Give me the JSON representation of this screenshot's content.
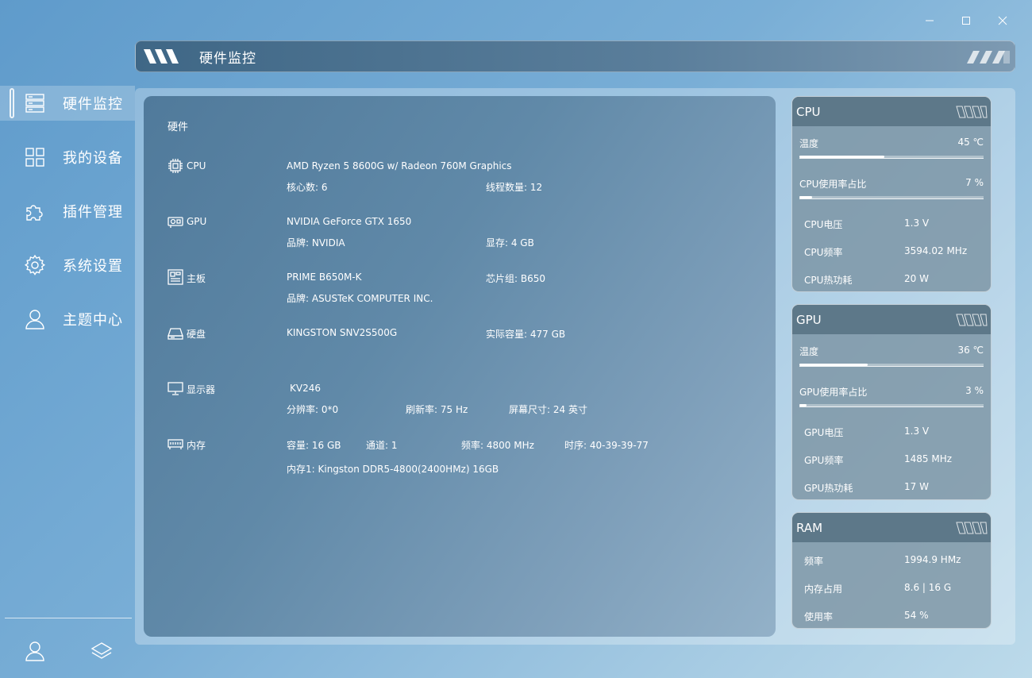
{
  "window": {
    "minimize": "—",
    "maximize": "☐",
    "close": "✕"
  },
  "header": {
    "title": "硬件监控"
  },
  "sidebar": {
    "items": [
      {
        "label": "硬件监控",
        "icon": "server-icon",
        "active": true
      },
      {
        "label": "我的设备",
        "icon": "grid-icon"
      },
      {
        "label": "插件管理",
        "icon": "puzzle-icon"
      },
      {
        "label": "系统设置",
        "icon": "gear-icon"
      },
      {
        "label": "主题中心",
        "icon": "user-icon"
      }
    ],
    "bottom": [
      "account-icon",
      "layers-icon"
    ]
  },
  "hardware": {
    "title": "硬件",
    "cpu": {
      "name": "CPU",
      "model": "AMD Ryzen 5 8600G w/ Radeon 760M Graphics",
      "cores": "核心数: 6",
      "threads": "线程数量: 12"
    },
    "gpu": {
      "name": "GPU",
      "model": "NVIDIA GeForce GTX 1650",
      "brand": "品牌: NVIDIA",
      "vram": "显存: 4 GB"
    },
    "board": {
      "name": "主板",
      "model": "PRIME B650M-K",
      "chipset": "芯片组: B650",
      "brand": "品牌: ASUSTeK COMPUTER INC."
    },
    "disk": {
      "name": "硬盘",
      "model": "KINGSTON SNV2S500G",
      "capacity": "实际容量: 477 GB"
    },
    "monitor": {
      "name": "显示器",
      "model": "KV246",
      "resolution": "分辨率: 0*0",
      "refresh": "刷新率: 75 Hz",
      "size": "屏幕尺寸: 24 英寸"
    },
    "memory": {
      "name": "内存",
      "capacity": "容量: 16 GB",
      "channels": "通道: 1",
      "frequency": "频率: 4800 MHz",
      "timing": "时序: 40-39-39-77",
      "module": "内存1: Kingston DDR5-4800(2400HMz) 16GB"
    }
  },
  "cards": {
    "cpu": {
      "title": "CPU",
      "temp_label": "温度",
      "temp_value": "45 ℃",
      "temp_fraction": 0.46,
      "usage_label": "CPU使用率占比",
      "usage_value": "7 %",
      "usage_fraction": 0.07,
      "voltage_label": "CPU电压",
      "voltage_value": "1.3 V",
      "freq_label": "CPU频率",
      "freq_value": "3594.02 MHz",
      "power_label": "CPU热功耗",
      "power_value": "20 W"
    },
    "gpu": {
      "title": "GPU",
      "temp_label": "温度",
      "temp_value": "36 ℃",
      "temp_fraction": 0.37,
      "usage_label": "GPU使用率占比",
      "usage_value": "3 %",
      "usage_fraction": 0.03,
      "voltage_label": "GPU电压",
      "voltage_value": "1.3 V",
      "freq_label": "GPU频率",
      "freq_value": "1485 MHz",
      "power_label": "GPU热功耗",
      "power_value": "17 W"
    },
    "ram": {
      "title": "RAM",
      "freq_label": "频率",
      "freq_value": "1994.9 HMz",
      "usage_label": "内存占用",
      "usage_value": "8.6 | 16 G",
      "rate_label": "使用率",
      "rate_value": "54 %"
    }
  },
  "colors": {
    "card_header": "#5d7889",
    "panel": "#6089a8",
    "accent": "#ffffff"
  }
}
